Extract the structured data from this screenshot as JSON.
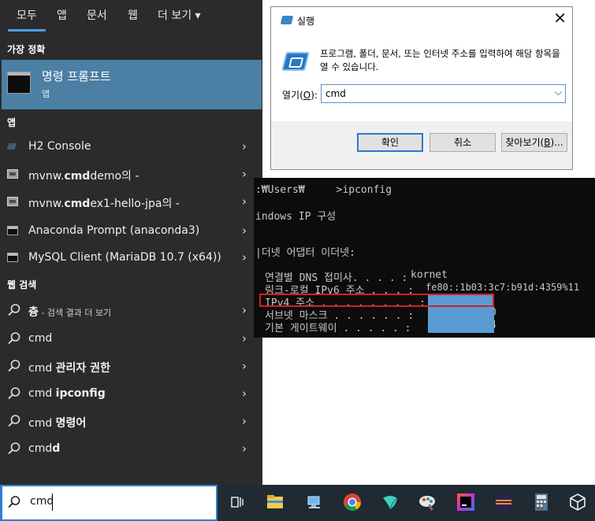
{
  "start_menu": {
    "tabs": [
      "모두",
      "앱",
      "문서",
      "웹",
      "더 보기 ▾"
    ],
    "best_match_header": "가장 정확",
    "best_match": {
      "title": "명령 프롬프트",
      "subtitle": "앱"
    },
    "apps_header": "앱",
    "apps": [
      {
        "pre": "H2 Console",
        "bold": "",
        "post": ""
      },
      {
        "pre": "mvnw.",
        "bold": "cmd",
        "post": "demo의 -"
      },
      {
        "pre": "mvnw.",
        "bold": "cmd",
        "post": "ex1-hello-jpa의 -"
      },
      {
        "pre": "Anaconda Prompt (anaconda3)",
        "bold": "",
        "post": ""
      },
      {
        "pre": "MySQL Client (MariaDB 10.7 (x64))",
        "bold": "",
        "post": ""
      }
    ],
    "web_header": "웹 검색",
    "web": [
      {
        "pre": "",
        "bold": "츙",
        "post": " - 검색 결과 더 보기"
      },
      {
        "pre": "cmd",
        "bold": "",
        "post": ""
      },
      {
        "pre": "cmd ",
        "bold": "관리자 권한",
        "post": ""
      },
      {
        "pre": "cmd ",
        "bold": "ipconfig",
        "post": ""
      },
      {
        "pre": "cmd ",
        "bold": "명령어",
        "post": ""
      },
      {
        "pre": "cmd",
        "bold": "d",
        "post": ""
      }
    ],
    "chevron": "›",
    "search_value": "cmd"
  },
  "run_dialog": {
    "title": "실행",
    "close": "✕",
    "description": "프로그램, 폴더, 문서, 또는 인터넷 주소를 입력하여 해당 항목을 열 수 있습니다.",
    "open_label_pre": "열기(",
    "open_label_key": "O",
    "open_label_post": "):",
    "input_value": "cmd",
    "dropdown": "⌵",
    "ok": "확인",
    "cancel": "취소",
    "browse_pre": "찾아보기(",
    "browse_key": "B",
    "browse_post": ")..."
  },
  "console": {
    "prompt_pre": ":₩Users₩",
    "prompt_post": ">ipconfig",
    "windows_ip": "indows IP 구성",
    "adapter": "|더넷 어댑터 이더넷:",
    "dns_label": "연결별 DNS 접미사. . . . :",
    "dns_value": "kornet",
    "link_label": "링크-로컬 IPv6 주소 . . . :",
    "link_value": "fe80::1b03:3c7:b91d:4359%11",
    "ipv4_label": "IPv4 주소 . . . . . . . . :",
    "subnet_label": "서브넷 마스크 . . . . . . :",
    "subnet_tail": "0",
    "gateway_label": "기본 게이트웨이 . . . . . :",
    "gateway_tail": "4"
  },
  "taskbar": {
    "icons": [
      "task-view-icon",
      "file-explorer-icon",
      "network-icon",
      "chrome-icon",
      "app-icon",
      "paint-icon",
      "intellij-icon",
      "eclipse-icon",
      "calculator-icon",
      "box-icon"
    ]
  }
}
